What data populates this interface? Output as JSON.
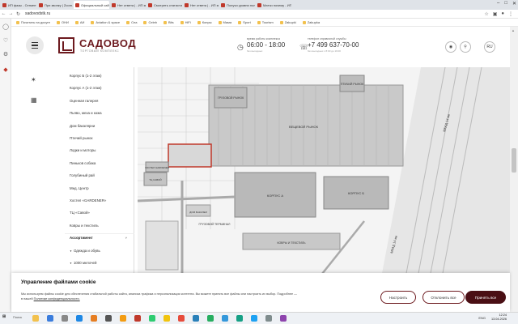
{
  "browser": {
    "tabs": [
      {
        "title": "ИП фазы - Сегменты"
      },
      {
        "title": "При звонку | Zoom. Ма"
      },
      {
        "title": "Официальный сайт - ТК"
      },
      {
        "title": "Нет ответа | - ИП мы"
      },
      {
        "title": "Смотреть статистику"
      },
      {
        "title": "Нет ответа | - ИП ме"
      },
      {
        "title": "Получи уровни поль"
      },
      {
        "title": "Матчи почему - ИП ме"
      }
    ],
    "active_tab_index": 2,
    "url": "sadovodstk.ru",
    "bookmarks": [
      "Почитать на досуге",
      "ОНИ",
      "AИ",
      "Aviation & space",
      "Сеа",
      "Celeb",
      "Bits",
      "HiFi",
      "Копры",
      "Мама",
      "Sport",
      "Tourism",
      "Zakupki",
      "Zakupka"
    ]
  },
  "header": {
    "brand": "САДОВОД",
    "brand_sub": "ТОРГОВЫЙ КОМПЛЕКС",
    "hours_label": "время работы комплекса",
    "hours": "06:00 - 18:00",
    "hours_note": "без выходных",
    "phone_label": "телефон справочной службы",
    "phone": "+7 499 637-70-00",
    "phone_note": "без выходных с 8:00 до 19:00",
    "lang": "RU"
  },
  "menu": {
    "items": [
      "Корпус Б (1-2 этаж)",
      "Корпус А (1-2 этаж)",
      "Оценная галерея",
      "Пьяво, меха и кожа",
      "Дом бакалярни",
      "Птичий рынок",
      "Лодки и моторы",
      "Пиньков собака",
      "Голубиный рай",
      "Мед. Центр",
      "Хостел «GARDENER»",
      "ТЦ «Савой»",
      "Ковры и текстиль"
    ],
    "accordion_label": "Ассортимент",
    "sub_items": [
      "Одежда и обувь",
      "1000 мелочей",
      "Товары для стройки"
    ]
  },
  "map": {
    "labels": {
      "lot1": "ГРУЗОВОЙ РЫНОК",
      "lot2": "ПТИЧИЙ РЫНОК",
      "main": "ВЕЩЕВОЙ РЫНОК",
      "korpa": "КОРПУС А",
      "korpb": "КОРПУС Б",
      "road": "МКАД 14 км",
      "road2": "МКАД 14 км",
      "terminal": "ГРУЗОВОЙ ТЕРМИНАЛ",
      "carpets": "КОВРЫ И ТЕКСТИЛЬ",
      "hostel": "ХОСТЕЛ GARDENER",
      "tc": "ТЦ САВОЙ",
      "dom": "ДОМ БАКАЛЕИ"
    }
  },
  "cookie": {
    "title": "Управление файлами cookie",
    "text": "Мы используем файлы cookie для обеспечения стабильной работы сайта, анализа трафика и персонализации контента. Вы можете принять все файлы или настроить их выбор. Подробнее —",
    "link_prefix": "в нашей",
    "link": "Политике конфиденциальности.",
    "btn_settings": "Настроить",
    "btn_reject": "Отклонить все",
    "btn_accept": "Принять все"
  },
  "taskbar": {
    "search": "Поиск",
    "time": "12:24",
    "date": "13.04.2026",
    "lang": "ENG"
  }
}
